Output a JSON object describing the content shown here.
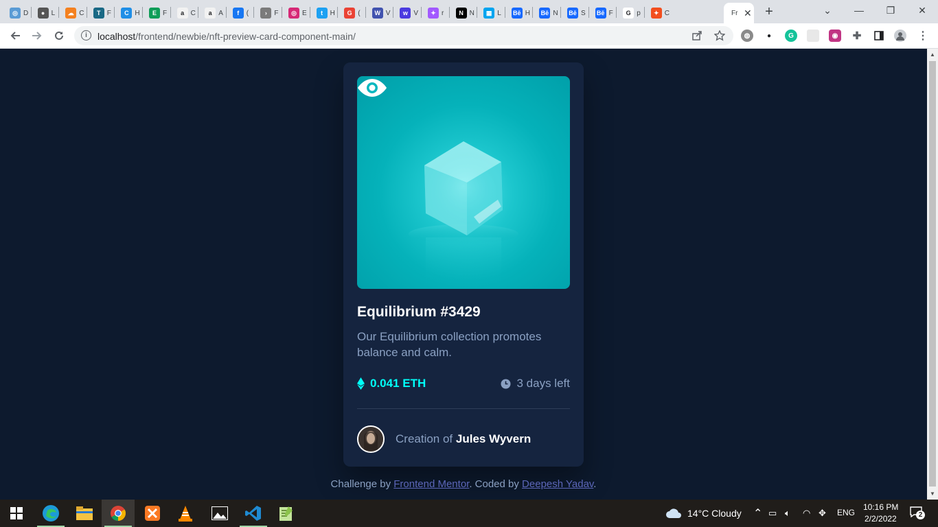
{
  "browser": {
    "tabs": [
      {
        "label": "D",
        "icon": "codesandbox-icon",
        "color": "#5a9bd5",
        "glyph": "◎"
      },
      {
        "label": "L",
        "icon": "globe-icon",
        "color": "#555555",
        "glyph": "●"
      },
      {
        "label": "C",
        "icon": "cloudflare-icon",
        "color": "#f48120",
        "glyph": "☁"
      },
      {
        "label": "F",
        "icon": "t-icon",
        "color": "#1a6985",
        "glyph": "T"
      },
      {
        "label": "H",
        "icon": "canva-icon",
        "color": "#1f8ee6",
        "glyph": "C"
      },
      {
        "label": "F",
        "icon": "e-icon",
        "color": "#0f9d58",
        "glyph": "E"
      },
      {
        "label": "C",
        "icon": "amazon-icon",
        "color": "#f2f2f2",
        "glyph": "a"
      },
      {
        "label": "A",
        "icon": "amazon-icon",
        "color": "#f2f2f2",
        "glyph": "a"
      },
      {
        "label": "(",
        "icon": "facebook-icon",
        "color": "#1877f2",
        "glyph": "f"
      },
      {
        "label": "F",
        "icon": "circle-arrow-icon",
        "color": "#7b7b7b",
        "glyph": "›"
      },
      {
        "label": "E",
        "icon": "instagram-icon",
        "color": "#d62976",
        "glyph": "◎"
      },
      {
        "label": "H",
        "icon": "twitter-icon",
        "color": "#1da1f2",
        "glyph": "t"
      },
      {
        "label": "(",
        "icon": "g-icon",
        "color": "#ea4335",
        "glyph": "G"
      },
      {
        "label": "V",
        "icon": "w-icon",
        "color": "#4153af",
        "glyph": "W"
      },
      {
        "label": "V",
        "icon": "w-icon",
        "color": "#4b3be0",
        "glyph": "w"
      },
      {
        "label": "r",
        "icon": "figma-icon",
        "color": "#a259ff",
        "glyph": "✦"
      },
      {
        "label": "N",
        "icon": "notion-icon",
        "color": "#000000",
        "glyph": "N"
      },
      {
        "label": "L",
        "icon": "microsoft-icon",
        "color": "#00a4ef",
        "glyph": "▦"
      },
      {
        "label": "H",
        "icon": "behance-icon",
        "color": "#1769ff",
        "glyph": "Bē"
      },
      {
        "label": "N",
        "icon": "behance-icon",
        "color": "#1769ff",
        "glyph": "Bē"
      },
      {
        "label": "S",
        "icon": "behance-icon",
        "color": "#1769ff",
        "glyph": "Bē"
      },
      {
        "label": "F",
        "icon": "behance-icon",
        "color": "#1769ff",
        "glyph": "Bē"
      },
      {
        "label": "p",
        "icon": "google-icon",
        "color": "#ffffff",
        "glyph": "G"
      },
      {
        "label": "C",
        "icon": "figma-icon",
        "color": "#f24e1e",
        "glyph": "✦"
      }
    ],
    "active_tab": {
      "label": "Fr",
      "close": "✕"
    },
    "new_tab": "+",
    "window_controls": {
      "dropdown": "⌄",
      "minimize": "—",
      "restore": "❐",
      "close": "✕"
    },
    "url_host": "localhost",
    "url_path": "/frontend/newbie/nft-preview-card-component-main/",
    "info_glyph": "i"
  },
  "card": {
    "title": "Equilibrium #3429",
    "description": "Our Equilibrium collection promotes balance and calm.",
    "price": "0.041 ETH",
    "time_left": "3 days left",
    "creator_prefix": "Creation of",
    "creator_name": "Jules Wyvern",
    "colors": {
      "cyan": "#00fff8",
      "soft_blue": "#8aa0c2",
      "card_bg": "#15243f",
      "page_bg": "#0d1a2e"
    }
  },
  "attribution": {
    "prefix": "Challenge by",
    "link1": "Frontend Mentor",
    "middle": ". Coded by",
    "link2": "Deepesh Yadav",
    "suffix": "."
  },
  "taskbar": {
    "weather": "14°C  Cloudy",
    "language": "ENG",
    "time": "10:16 PM",
    "date": "2/2/2022",
    "notifications": "2"
  }
}
